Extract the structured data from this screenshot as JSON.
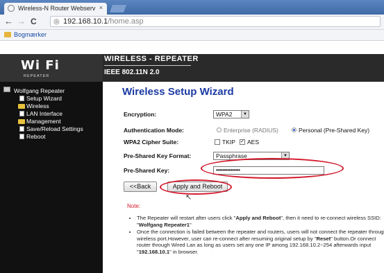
{
  "browser": {
    "tab_title": "Wireless-N Router Webserv",
    "tab_close": "×",
    "back": "←",
    "forward": "→",
    "reload": "C",
    "url_host": "192.168.10.1",
    "url_path": "/home.asp",
    "bookmarks_label": "Bogmærker"
  },
  "header": {
    "logo_text": "Wi  Fi",
    "logo_sub": "REPEATER",
    "line1": "WIRELESS - REPEATER",
    "line2": "IEEE 802.11N 2.0"
  },
  "sidebar": {
    "root": "Wolfgang Repeater",
    "items": [
      {
        "label": "Setup Wizard",
        "icon": "page-icon"
      },
      {
        "label": "Wireless",
        "icon": "folder-icon"
      },
      {
        "label": "LAN Interface",
        "icon": "page-icon"
      },
      {
        "label": "Management",
        "icon": "folder-icon"
      },
      {
        "label": "Save/Reload Settings",
        "icon": "page-icon"
      },
      {
        "label": "Reboot",
        "icon": "page-icon"
      }
    ]
  },
  "wizard": {
    "title": "Wireless Setup Wizard",
    "encryption_label": "Encryption:",
    "encryption_value": "WPA2",
    "auth_label": "Authentication Mode:",
    "auth_options": [
      "Enterprise (RADIUS)",
      "Personal (Pre-Shared Key)"
    ],
    "auth_selected": "Personal (Pre-Shared Key)",
    "cipher_label": "WPA2 Cipher Suite:",
    "cipher_tkip": "TKIP",
    "cipher_tkip_checked": false,
    "cipher_aes": "AES",
    "cipher_aes_checked": true,
    "psk_format_label": "Pre-Shared Key Format:",
    "psk_format_value": "Passphrase",
    "psk_label": "Pre-Shared Key:",
    "psk_value": "•••••••••••••••",
    "back_button": "<<Back",
    "apply_button": "Apply and Reboot",
    "highlight_color": "#d3172a"
  },
  "notes": {
    "title": "Note:",
    "item1_a": "The Repeater will restart after users click \"",
    "item1_b": "Apply and Reboot",
    "item1_c": "\", then it need to re-connect wireless SSID: \"",
    "item1_d": "Wolfgang Repeater1",
    "item1_e": "\"",
    "item2_a": "Once the connection is failed between the repeater and routers, users will not connect the repeater through wireless port.However, user can re-connect after resuming original setup by \"",
    "item2_b": "Reset",
    "item2_c": "\" button.Or connect router through Wired Lan as long as users set any one IP among 192.168.10.2~254 afterwards input \"",
    "item2_d": "192.168.10.1",
    "item2_e": "\" in browser."
  }
}
